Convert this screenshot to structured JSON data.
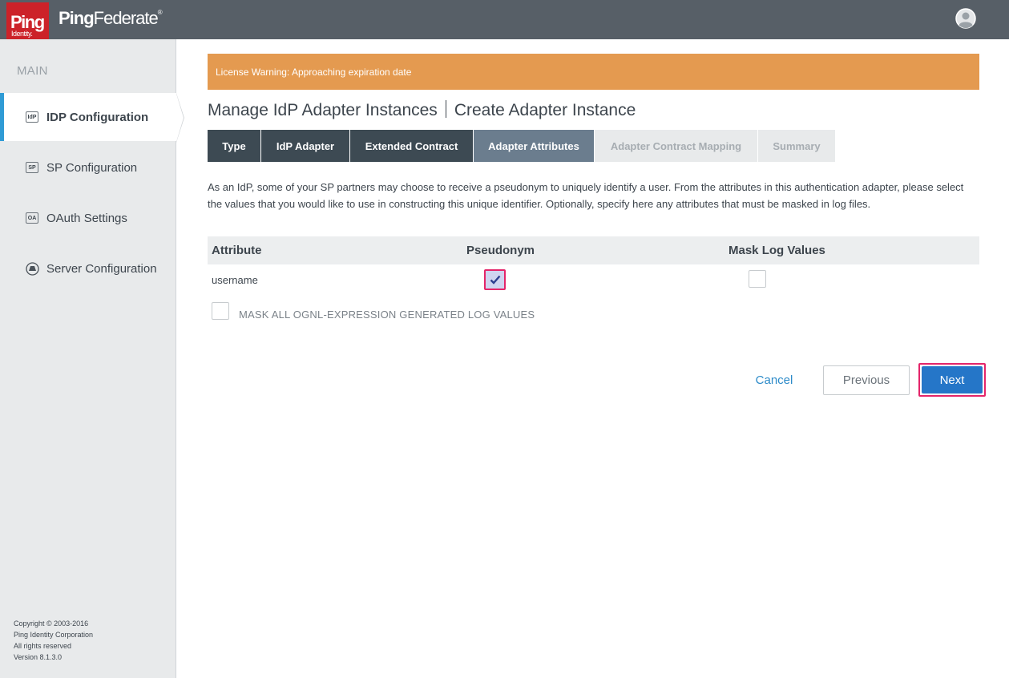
{
  "header": {
    "logo_main": "Ping",
    "logo_sub": "Identity.",
    "brand_bold": "Ping",
    "brand_light": "Federate",
    "brand_mark": "®",
    "user_icon": "user-circle-icon"
  },
  "sidebar": {
    "heading": "MAIN",
    "items": [
      {
        "icon_text": "IdP",
        "label": "IDP Configuration",
        "active": true
      },
      {
        "icon_text": "SP",
        "label": "SP Configuration",
        "active": false
      },
      {
        "icon_text": "OA",
        "label": "OAuth Settings",
        "active": false
      },
      {
        "icon_text": "",
        "label": "Server Configuration",
        "active": false
      }
    ],
    "copyright": {
      "line1": "Copyright © 2003-2016",
      "line2": "Ping Identity Corporation",
      "line3": "All rights reserved",
      "line4": "Version 8.1.3.0"
    }
  },
  "license_warning": "License Warning: Approaching expiration date",
  "title": {
    "part1": "Manage IdP Adapter Instances",
    "part2": "Create Adapter Instance"
  },
  "tabs": [
    {
      "label": "Type",
      "state": "done"
    },
    {
      "label": "IdP Adapter",
      "state": "done"
    },
    {
      "label": "Extended Contract",
      "state": "done"
    },
    {
      "label": "Adapter Attributes",
      "state": "current"
    },
    {
      "label": "Adapter Contract Mapping",
      "state": "todo"
    },
    {
      "label": "Summary",
      "state": "todo"
    }
  ],
  "description": "As an IdP, some of your SP partners may choose to receive a pseudonym to uniquely identify a user. From the attributes in this authentication adapter, please select the values that you would like to use in constructing this unique identifier. Optionally, specify here any attributes that must be masked in log files.",
  "table": {
    "headers": {
      "attribute": "Attribute",
      "pseudonym": "Pseudonym",
      "mask": "Mask Log Values"
    },
    "rows": [
      {
        "attribute": "username",
        "pseudonym": true,
        "mask": false
      }
    ]
  },
  "mask_all": {
    "label": "MASK ALL OGNL-EXPRESSION GENERATED LOG VALUES",
    "checked": false
  },
  "buttons": {
    "cancel": "Cancel",
    "previous": "Previous",
    "next": "Next"
  },
  "colors": {
    "topbar": "#575f67",
    "logo_red": "#cc2229",
    "license_orange": "#e49a50",
    "accent_blue": "#2576c8",
    "highlight_pink": "#e4256a"
  }
}
